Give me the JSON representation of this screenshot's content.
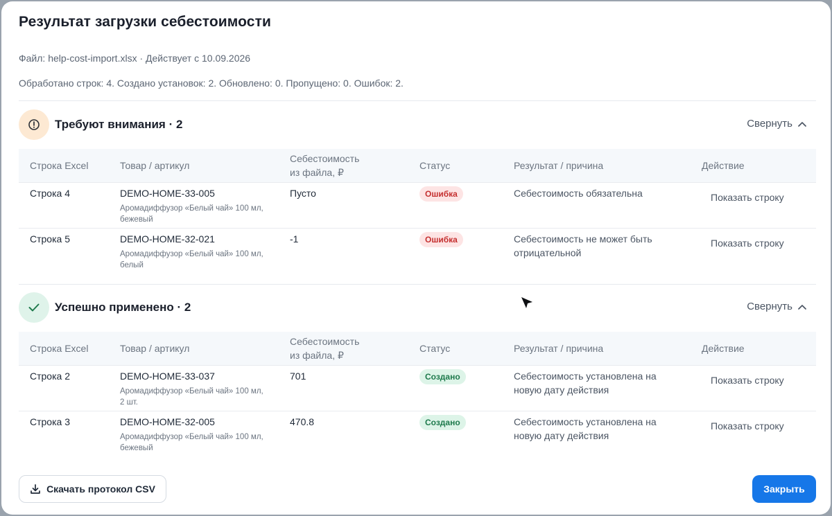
{
  "dialog": {
    "title": "Результат загрузки себестоимости",
    "file_line": "Файл: help-cost-import.xlsx · Действует с 10.09.2026",
    "summary_line": "Обработано строк: 4. Создано установок: 2. Обновлено: 0. Пропущено: 0. Ошибок: 2."
  },
  "columns": {
    "row": "Строка Excel",
    "product": "Товар / артикул",
    "cost_line1": "Себестоимость",
    "cost_line2": "из файла, ₽",
    "status": "Статус",
    "result": "Результат / причина",
    "action": "Действие"
  },
  "attention": {
    "title": "Требуют внимания · 2",
    "collapse_label": "Свернуть",
    "rows": [
      {
        "row": "Строка 4",
        "sku": "DEMO-HOME-33-005",
        "name_line1": "Аромадиффузор «Белый чай» 100 мл,",
        "name_line2": "бежевый",
        "cost": "Пусто",
        "status": "Ошибка",
        "reason_line1": "Себестоимость обязательна",
        "reason_line2": "",
        "action": "Показать строку"
      },
      {
        "row": "Строка 5",
        "sku": "DEMO-HOME-32-021",
        "name_line1": "Аромадиффузор «Белый чай» 100 мл,",
        "name_line2": "белый",
        "cost": "-1",
        "status": "Ошибка",
        "reason_line1": "Себестоимость не может быть",
        "reason_line2": "отрицательной",
        "action": "Показать строку"
      }
    ]
  },
  "success": {
    "title": "Успешно применено · 2",
    "collapse_label": "Свернуть",
    "rows": [
      {
        "row": "Строка 2",
        "sku": "DEMO-HOME-33-037",
        "name_line1": "Аромадиффузор «Белый чай» 100 мл,",
        "name_line2": "2 шт.",
        "cost": "701",
        "status": "Создано",
        "reason_line1": "Себестоимость установлена на",
        "reason_line2": "новую дату действия",
        "action": "Показать строку"
      },
      {
        "row": "Строка 3",
        "sku": "DEMO-HOME-32-005",
        "name_line1": "Аромадиффузор «Белый чай» 100 мл,",
        "name_line2": "бежевый",
        "cost": "470.8",
        "status": "Создано",
        "reason_line1": "Себестоимость установлена на",
        "reason_line2": "новую дату действия",
        "action": "Показать строку"
      }
    ]
  },
  "footer": {
    "download_label": "Скачать протокол CSV",
    "close_label": "Закрыть"
  },
  "icons": {
    "warning": "warning-circle-icon",
    "success": "check-icon",
    "collapse": "chevron-up-icon",
    "download": "download-icon",
    "cursor": "mouse-cursor-icon"
  },
  "colors": {
    "accent": "#1677e8",
    "error_badge_bg": "#fde4e4",
    "error_badge_text": "#c53030",
    "success_badge_bg": "#ddf4e8",
    "success_badge_text": "#1e7a4c",
    "warning_icon_bg": "#fde9d3",
    "success_icon_bg": "#dff3ea"
  }
}
